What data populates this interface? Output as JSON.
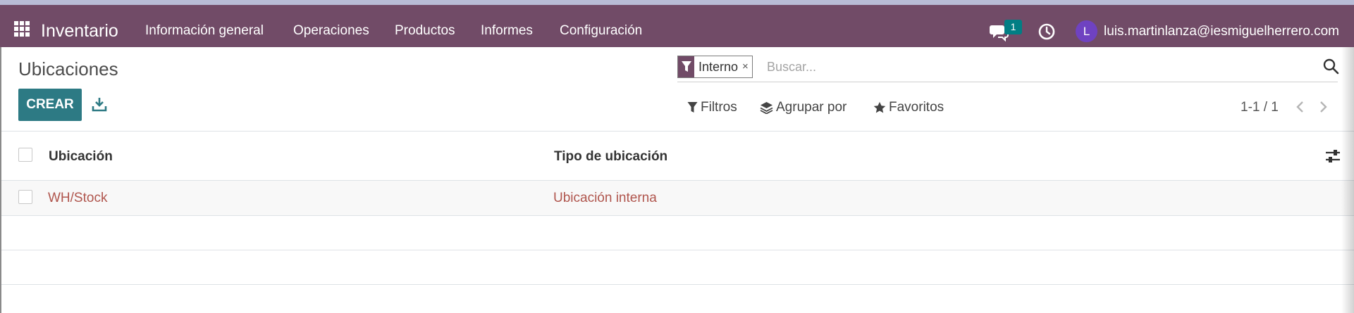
{
  "navbar": {
    "app_name": "Inventario",
    "menu": [
      "Información general",
      "Operaciones",
      "Productos",
      "Informes",
      "Configuración"
    ],
    "chat_count": "1",
    "avatar_initial": "L",
    "user_email": "luis.martinlanza@iesmiguelherrero.com",
    "icons": [
      "apps-grid-icon",
      "chat-icon",
      "clock-icon"
    ]
  },
  "page": {
    "title": "Ubicaciones",
    "create_label": "CREAR",
    "download_icon": "download-icon"
  },
  "search": {
    "facet_label": "Interno",
    "facet_remove": "×",
    "placeholder": "Buscar...",
    "icon": "search-icon"
  },
  "controls": {
    "filters": "Filtros",
    "group_by": "Agrupar por",
    "favorites": "Favoritos",
    "pager": "1-1 / 1"
  },
  "table": {
    "columns": [
      "Ubicación",
      "Tipo de ubicación"
    ],
    "rows": [
      {
        "ubicacion": "WH/Stock",
        "tipo": "Ubicación interna"
      }
    ]
  },
  "colors": {
    "navbar": "#714b67",
    "primary_button": "#2d7a84",
    "badge": "#017e84",
    "link": "#b0564e"
  }
}
